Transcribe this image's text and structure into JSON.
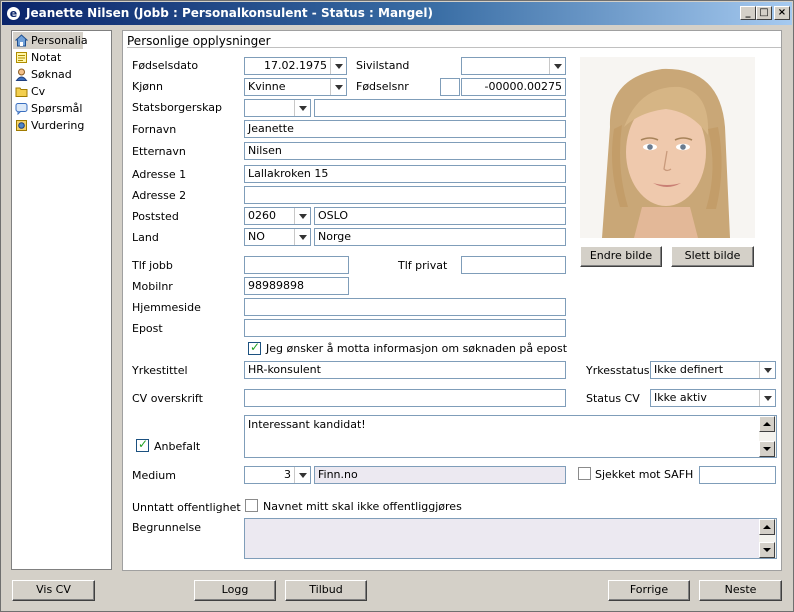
{
  "window": {
    "title": "Jeanette Nilsen (Jobb : Personalkonsulent - Status : Mangel)",
    "app_icon": "e",
    "controls": {
      "minimize": "_",
      "maximize": "□",
      "close": "×"
    }
  },
  "nav": {
    "items": [
      {
        "label": "Personalia",
        "icon": "house-icon"
      },
      {
        "label": "Notat",
        "icon": "note-icon"
      },
      {
        "label": "Søknad",
        "icon": "person-icon"
      },
      {
        "label": "Cv",
        "icon": "folder-icon"
      },
      {
        "label": "Spørsmål",
        "icon": "question-icon"
      },
      {
        "label": "Vurdering",
        "icon": "evaluation-icon"
      }
    ],
    "active": "Personalia"
  },
  "panel": {
    "header": "Personlige opplysninger"
  },
  "form": {
    "fodselsdato": {
      "label": "Fødselsdato",
      "value": "17.02.1975"
    },
    "sivilstand": {
      "label": "Sivilstand",
      "value": ""
    },
    "kjonn": {
      "label": "Kjønn",
      "value": "Kvinne"
    },
    "fodselsnr": {
      "label": "Fødselsnr",
      "prefix": "",
      "value": "-00000.00275"
    },
    "statsborgerskap": {
      "label": "Statsborgerskap",
      "code": "",
      "value": ""
    },
    "fornavn": {
      "label": "Fornavn",
      "value": "Jeanette"
    },
    "etternavn": {
      "label": "Etternavn",
      "value": "Nilsen"
    },
    "adresse1": {
      "label": "Adresse 1",
      "value": "Lallakroken 15"
    },
    "adresse2": {
      "label": "Adresse 2",
      "value": ""
    },
    "poststed": {
      "label": "Poststed",
      "code": "0260",
      "value": "OSLO"
    },
    "land": {
      "label": "Land",
      "code": "NO",
      "value": "Norge"
    },
    "tlf_jobb": {
      "label": "Tlf jobb",
      "value": ""
    },
    "tlf_privat": {
      "label": "Tlf privat",
      "value": ""
    },
    "mobilnr": {
      "label": "Mobilnr",
      "value": "98989898"
    },
    "hjemmeside": {
      "label": "Hjemmeside",
      "value": ""
    },
    "epost": {
      "label": "Epost",
      "value": ""
    },
    "epost_info": {
      "label": "Jeg ønsker å motta informasjon om søknaden på epost",
      "checked": true
    },
    "yrkestittel": {
      "label": "Yrkestittel",
      "value": "HR-konsulent"
    },
    "yrkesstatus": {
      "label": "Yrkesstatus",
      "value": "Ikke definert"
    },
    "cv_overskrift": {
      "label": "CV overskrift",
      "value": ""
    },
    "status_cv": {
      "label": "Status CV",
      "value": "Ikke aktiv"
    },
    "anbefalt": {
      "label": "Anbefalt",
      "checked": true,
      "note": "Interessant kandidat!"
    },
    "medium": {
      "label": "Medium",
      "code": "3",
      "value": "Finn.no"
    },
    "sjekket_safh": {
      "label": "Sjekket mot SAFH",
      "checked": false,
      "value": ""
    },
    "unntatt": {
      "label": "Unntatt offentlighet",
      "checkbox_label": "Navnet mitt skal ikke offentliggjøres",
      "checked": false
    },
    "begrunnelse": {
      "label": "Begrunnelse",
      "value": ""
    }
  },
  "photo": {
    "alt": "Portrett av Jeanette Nilsen"
  },
  "photo_buttons": {
    "change": "Endre bilde",
    "delete": "Slett bilde"
  },
  "footer": {
    "vis_cv": "Vis CV",
    "logg": "Logg",
    "tilbud": "Tilbud",
    "forrige": "Forrige",
    "neste": "Neste"
  },
  "colors": {
    "title_start": "#0a246a",
    "title_end": "#a6caf0",
    "field_border": "#7f9db9",
    "window_bg": "#d4d0c8"
  }
}
